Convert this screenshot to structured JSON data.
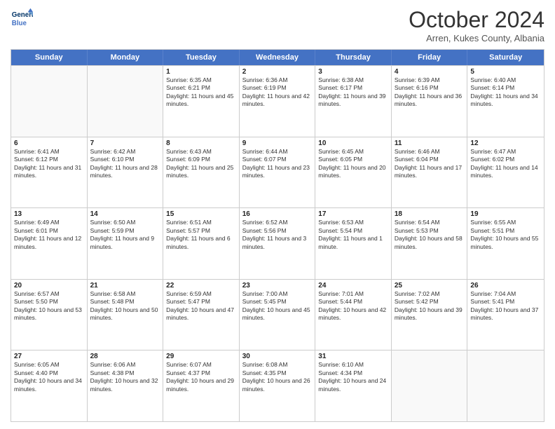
{
  "header": {
    "logo_line1": "General",
    "logo_line2": "Blue",
    "month": "October 2024",
    "location": "Arren, Kukes County, Albania"
  },
  "days_of_week": [
    "Sunday",
    "Monday",
    "Tuesday",
    "Wednesday",
    "Thursday",
    "Friday",
    "Saturday"
  ],
  "weeks": [
    [
      {
        "day": "",
        "sunrise": "",
        "sunset": "",
        "daylight": ""
      },
      {
        "day": "",
        "sunrise": "",
        "sunset": "",
        "daylight": ""
      },
      {
        "day": "1",
        "sunrise": "Sunrise: 6:35 AM",
        "sunset": "Sunset: 6:21 PM",
        "daylight": "Daylight: 11 hours and 45 minutes."
      },
      {
        "day": "2",
        "sunrise": "Sunrise: 6:36 AM",
        "sunset": "Sunset: 6:19 PM",
        "daylight": "Daylight: 11 hours and 42 minutes."
      },
      {
        "day": "3",
        "sunrise": "Sunrise: 6:38 AM",
        "sunset": "Sunset: 6:17 PM",
        "daylight": "Daylight: 11 hours and 39 minutes."
      },
      {
        "day": "4",
        "sunrise": "Sunrise: 6:39 AM",
        "sunset": "Sunset: 6:16 PM",
        "daylight": "Daylight: 11 hours and 36 minutes."
      },
      {
        "day": "5",
        "sunrise": "Sunrise: 6:40 AM",
        "sunset": "Sunset: 6:14 PM",
        "daylight": "Daylight: 11 hours and 34 minutes."
      }
    ],
    [
      {
        "day": "6",
        "sunrise": "Sunrise: 6:41 AM",
        "sunset": "Sunset: 6:12 PM",
        "daylight": "Daylight: 11 hours and 31 minutes."
      },
      {
        "day": "7",
        "sunrise": "Sunrise: 6:42 AM",
        "sunset": "Sunset: 6:10 PM",
        "daylight": "Daylight: 11 hours and 28 minutes."
      },
      {
        "day": "8",
        "sunrise": "Sunrise: 6:43 AM",
        "sunset": "Sunset: 6:09 PM",
        "daylight": "Daylight: 11 hours and 25 minutes."
      },
      {
        "day": "9",
        "sunrise": "Sunrise: 6:44 AM",
        "sunset": "Sunset: 6:07 PM",
        "daylight": "Daylight: 11 hours and 23 minutes."
      },
      {
        "day": "10",
        "sunrise": "Sunrise: 6:45 AM",
        "sunset": "Sunset: 6:05 PM",
        "daylight": "Daylight: 11 hours and 20 minutes."
      },
      {
        "day": "11",
        "sunrise": "Sunrise: 6:46 AM",
        "sunset": "Sunset: 6:04 PM",
        "daylight": "Daylight: 11 hours and 17 minutes."
      },
      {
        "day": "12",
        "sunrise": "Sunrise: 6:47 AM",
        "sunset": "Sunset: 6:02 PM",
        "daylight": "Daylight: 11 hours and 14 minutes."
      }
    ],
    [
      {
        "day": "13",
        "sunrise": "Sunrise: 6:49 AM",
        "sunset": "Sunset: 6:01 PM",
        "daylight": "Daylight: 11 hours and 12 minutes."
      },
      {
        "day": "14",
        "sunrise": "Sunrise: 6:50 AM",
        "sunset": "Sunset: 5:59 PM",
        "daylight": "Daylight: 11 hours and 9 minutes."
      },
      {
        "day": "15",
        "sunrise": "Sunrise: 6:51 AM",
        "sunset": "Sunset: 5:57 PM",
        "daylight": "Daylight: 11 hours and 6 minutes."
      },
      {
        "day": "16",
        "sunrise": "Sunrise: 6:52 AM",
        "sunset": "Sunset: 5:56 PM",
        "daylight": "Daylight: 11 hours and 3 minutes."
      },
      {
        "day": "17",
        "sunrise": "Sunrise: 6:53 AM",
        "sunset": "Sunset: 5:54 PM",
        "daylight": "Daylight: 11 hours and 1 minute."
      },
      {
        "day": "18",
        "sunrise": "Sunrise: 6:54 AM",
        "sunset": "Sunset: 5:53 PM",
        "daylight": "Daylight: 10 hours and 58 minutes."
      },
      {
        "day": "19",
        "sunrise": "Sunrise: 6:55 AM",
        "sunset": "Sunset: 5:51 PM",
        "daylight": "Daylight: 10 hours and 55 minutes."
      }
    ],
    [
      {
        "day": "20",
        "sunrise": "Sunrise: 6:57 AM",
        "sunset": "Sunset: 5:50 PM",
        "daylight": "Daylight: 10 hours and 53 minutes."
      },
      {
        "day": "21",
        "sunrise": "Sunrise: 6:58 AM",
        "sunset": "Sunset: 5:48 PM",
        "daylight": "Daylight: 10 hours and 50 minutes."
      },
      {
        "day": "22",
        "sunrise": "Sunrise: 6:59 AM",
        "sunset": "Sunset: 5:47 PM",
        "daylight": "Daylight: 10 hours and 47 minutes."
      },
      {
        "day": "23",
        "sunrise": "Sunrise: 7:00 AM",
        "sunset": "Sunset: 5:45 PM",
        "daylight": "Daylight: 10 hours and 45 minutes."
      },
      {
        "day": "24",
        "sunrise": "Sunrise: 7:01 AM",
        "sunset": "Sunset: 5:44 PM",
        "daylight": "Daylight: 10 hours and 42 minutes."
      },
      {
        "day": "25",
        "sunrise": "Sunrise: 7:02 AM",
        "sunset": "Sunset: 5:42 PM",
        "daylight": "Daylight: 10 hours and 39 minutes."
      },
      {
        "day": "26",
        "sunrise": "Sunrise: 7:04 AM",
        "sunset": "Sunset: 5:41 PM",
        "daylight": "Daylight: 10 hours and 37 minutes."
      }
    ],
    [
      {
        "day": "27",
        "sunrise": "Sunrise: 6:05 AM",
        "sunset": "Sunset: 4:40 PM",
        "daylight": "Daylight: 10 hours and 34 minutes."
      },
      {
        "day": "28",
        "sunrise": "Sunrise: 6:06 AM",
        "sunset": "Sunset: 4:38 PM",
        "daylight": "Daylight: 10 hours and 32 minutes."
      },
      {
        "day": "29",
        "sunrise": "Sunrise: 6:07 AM",
        "sunset": "Sunset: 4:37 PM",
        "daylight": "Daylight: 10 hours and 29 minutes."
      },
      {
        "day": "30",
        "sunrise": "Sunrise: 6:08 AM",
        "sunset": "Sunset: 4:35 PM",
        "daylight": "Daylight: 10 hours and 26 minutes."
      },
      {
        "day": "31",
        "sunrise": "Sunrise: 6:10 AM",
        "sunset": "Sunset: 4:34 PM",
        "daylight": "Daylight: 10 hours and 24 minutes."
      },
      {
        "day": "",
        "sunrise": "",
        "sunset": "",
        "daylight": ""
      },
      {
        "day": "",
        "sunrise": "",
        "sunset": "",
        "daylight": ""
      }
    ]
  ]
}
